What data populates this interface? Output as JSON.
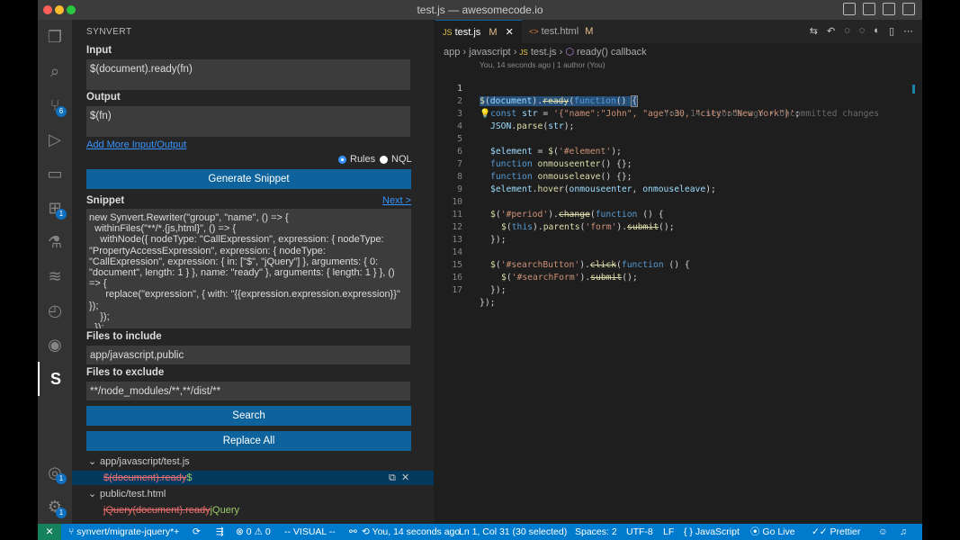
{
  "window": {
    "title": "test.js — awesomecode.io"
  },
  "activity_bar": {
    "source_control_badge": "6",
    "extensions_badge": "1",
    "settings_badge": "1",
    "synvert_glyph": "S"
  },
  "sidebar": {
    "title": "SYNVERT",
    "input_label": "Input",
    "input_value": "$(document).ready(fn)",
    "output_label": "Output",
    "output_value": "$(fn)",
    "add_more_link": "Add More Input/Output",
    "radio_rules": "Rules",
    "radio_nql": "NQL",
    "generate_button": "Generate Snippet",
    "snippet_label": "Snippet",
    "next_link": "Next >",
    "snippet_code": "new Synvert.Rewriter(\"group\", \"name\", () => {\n  withinFiles(\"**/*.{js,html}\", () => {\n    withNode({ nodeType: \"CallExpression\", expression: { nodeType: \"PropertyAccessExpression\", expression: { nodeType: \"CallExpression\", expression: { in: [\"$\", \"jQuery\"] }, arguments: { 0: \"document\", length: 1 } }, name: \"ready\" }, arguments: { length: 1 } }, () => {\n      replace(\"expression\", { with: \"{{expression.expression.expression}}\" });\n    });\n  });\n});",
    "files_include_label": "Files to include",
    "files_include_value": "app/javascript,public",
    "files_exclude_label": "Files to exclude",
    "files_exclude_value": "**/node_modules/**,**/dist/**",
    "search_button": "Search",
    "replace_all_button": "Replace All",
    "results": [
      {
        "file": "app/javascript/test.js",
        "match_old": "$(document).ready",
        "match_new": "$"
      },
      {
        "file": "public/test.html",
        "match_old": "jQuery(document).ready",
        "match_new": "jQuery"
      }
    ]
  },
  "editor": {
    "tabs": [
      {
        "icon": "JS",
        "label": "test.js",
        "status": "M"
      },
      {
        "icon": "<>",
        "label": "test.html",
        "status": "M"
      }
    ],
    "breadcrumb": [
      "app",
      "javascript",
      "test.js",
      "ready() callback"
    ],
    "codelens": "You, 14 seconds ago | 1 author (You)",
    "blame": "You, 14 seconds ago • Uncommitted changes",
    "line_numbers": [
      "1",
      "2",
      "3",
      "4",
      "5",
      "6",
      "7",
      "8",
      "9",
      "10",
      "11",
      "12",
      "13",
      "14",
      "15",
      "16",
      "17"
    ]
  },
  "status_bar": {
    "branch": "synvert/migrate-jquery*+",
    "problems": "0",
    "warnings": "0",
    "mode": "-- VISUAL --",
    "git_blame": "You, 14 seconds ago",
    "position": "Ln 1, Col 31 (30 selected)",
    "spaces": "Spaces: 2",
    "encoding": "UTF-8",
    "eol": "LF",
    "language": "JavaScript",
    "golive": "Go Live",
    "prettier": "Prettier"
  }
}
